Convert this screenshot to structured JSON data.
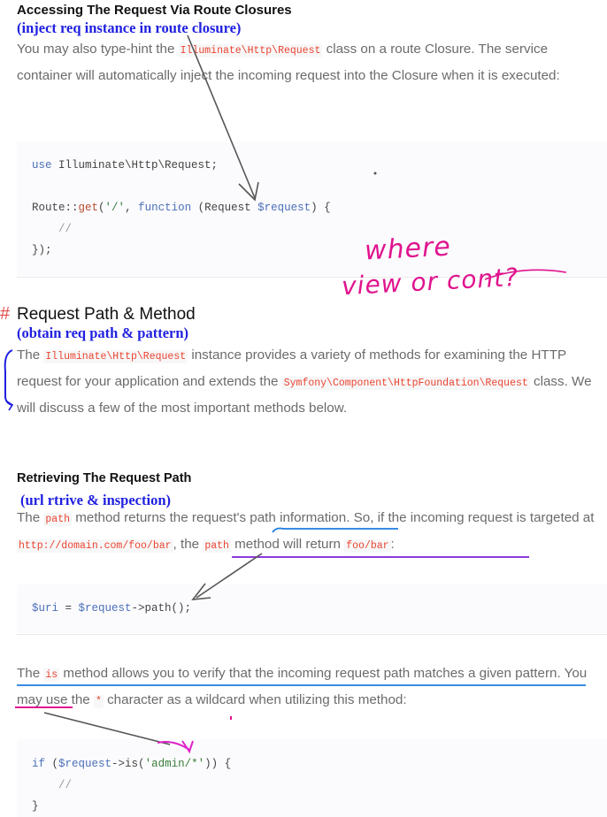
{
  "section1": {
    "heading": "Accessing The Request Via Route Closures",
    "note": "(inject req instance in route closure)",
    "p_before": "You may also type-hint the ",
    "p_code": "Illuminate\\Http\\Request",
    "p_after": " class on a route Closure. The service container will automatically inject the incoming request into the Closure when it is executed:"
  },
  "code1": {
    "line1_kw": "use",
    "line1_rest": " Illuminate\\Http\\Request;",
    "line2_a": "Route::",
    "line2_fn": "get",
    "line2_b": "(",
    "line2_str": "'/'",
    "line2_c": ", ",
    "line2_kw": "function",
    "line2_d": " (Request ",
    "line2_var": "$request",
    "line2_e": ") {",
    "line3": "//",
    "line4": "});"
  },
  "handwriting1": {
    "line1": "where",
    "line2": "view or cont?"
  },
  "section2": {
    "hash": "#",
    "heading": "Request Path & Method",
    "note": "(obtain req path & pattern)",
    "p_a": "The ",
    "p_code1": "Illuminate\\Http\\Request",
    "p_b": " instance provides a variety of methods for examining the HTTP request for your application and extends the ",
    "p_code2": "Symfony\\Component\\HttpFoundation\\Request",
    "p_c": " class. We will discuss a few of the most important methods below."
  },
  "section3": {
    "heading": "Retrieving The Request Path",
    "note": "(url rtrive & inspection)",
    "p_a": "The ",
    "p_code1": "path",
    "p_b": " method returns the request's path information. So, if the incoming request is targeted at ",
    "p_code2": "http://domain.com/foo/bar",
    "p_c": ", the ",
    "p_code3": "path",
    "p_d": " method will return ",
    "p_code4": "foo/bar",
    "p_e": ":"
  },
  "code2": {
    "var1": "$uri",
    "eq": " = ",
    "var2": "$request",
    "rest": "->path();"
  },
  "section4": {
    "p_a": "The ",
    "p_code1": "is",
    "p_b": " method allows you to verify that the incoming request path matches a given pattern. You may use the ",
    "p_code2": "*",
    "p_c": " character as a wildcard when utilizing this method:"
  },
  "code3": {
    "line1_kw": "if",
    "line1_a": " (",
    "line1_var": "$request",
    "line1_b": "->is(",
    "line1_str": "'admin/*'",
    "line1_c": ")) {",
    "line2": "//",
    "line3": "}"
  },
  "colors": {
    "annotation_blue": "#1f1fe0",
    "handwriting_magenta": "#e0148e",
    "underline_purple": "#7b1fd6",
    "arrow_gray": "#777777"
  }
}
